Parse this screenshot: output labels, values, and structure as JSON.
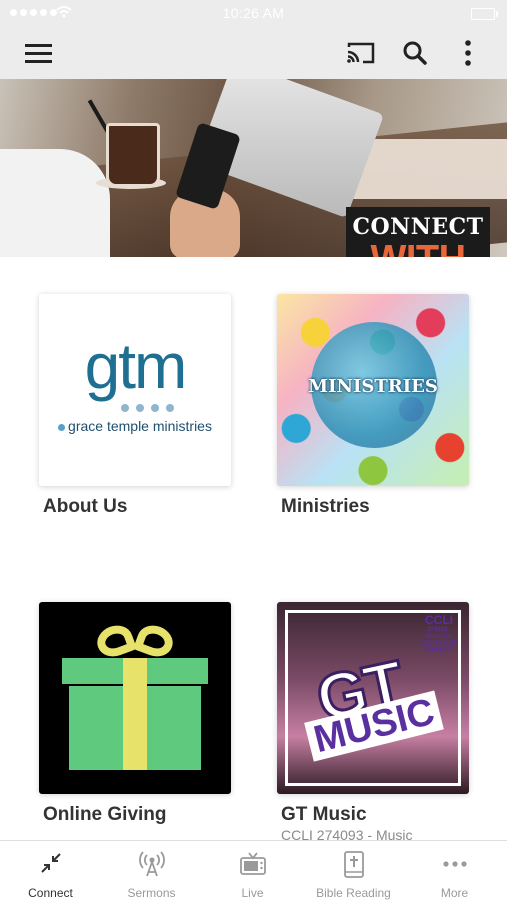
{
  "status_bar": {
    "time": "10:26 AM"
  },
  "app_bar": {
    "icons": [
      "menu-icon",
      "cast-icon",
      "search-icon",
      "more-vert-icon"
    ]
  },
  "hero": {
    "line1": "CONNECT",
    "line2": "WITH US",
    "accent": "#e9663a"
  },
  "tiles": [
    {
      "label": "About Us",
      "logo_word": "gtm",
      "logo_sub": "grace temple ministries"
    },
    {
      "label": "Ministries",
      "image_title": "MINISTRIES"
    },
    {
      "label": "Online Giving"
    },
    {
      "label": "GT Music",
      "sublabel": "CCLI 274093 - Music",
      "image_word1": "GT",
      "image_word2": "MUSIC",
      "ccli_line1": "CCLI",
      "ccli_line2": "274093 - MUSICAL COPYRIGHT LICENSE"
    }
  ],
  "bottom_nav": [
    {
      "label": "Connect",
      "icon": "arrows-collapse-icon",
      "active": true
    },
    {
      "label": "Sermons",
      "icon": "broadcast-icon",
      "active": false
    },
    {
      "label": "Live",
      "icon": "tv-icon",
      "active": false
    },
    {
      "label": "Bible Reading",
      "icon": "bible-icon",
      "active": false
    },
    {
      "label": "More",
      "icon": "more-horiz-icon",
      "active": false
    }
  ]
}
